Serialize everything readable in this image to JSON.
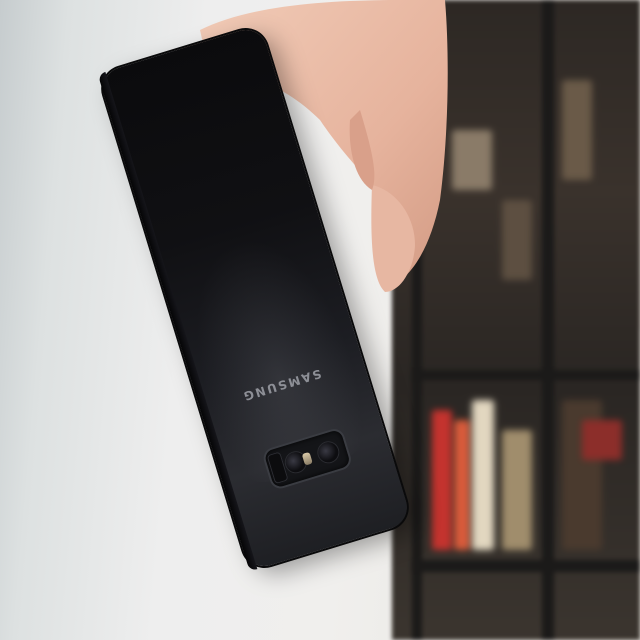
{
  "photo": {
    "subject": "phone-held-in-hand",
    "brand_text": "SAMSUNG",
    "colors": {
      "phone_body": "#111114",
      "background": "#eeeeee",
      "skin": "#e8b9a4",
      "shelf": "#2d2824"
    }
  }
}
